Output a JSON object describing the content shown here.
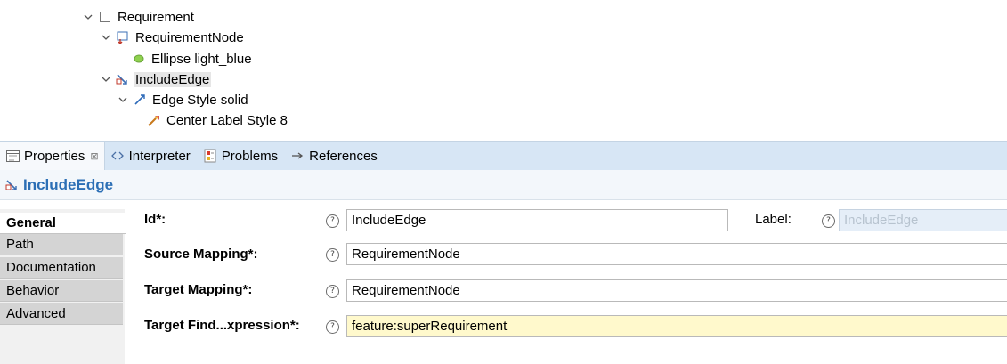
{
  "tree": {
    "items": [
      {
        "label": "Requirement",
        "icon": "document-icon",
        "expanded": true
      },
      {
        "label": "RequirementNode",
        "icon": "node-mapping-icon",
        "expanded": true
      },
      {
        "label": "Ellipse light_blue",
        "icon": "ellipse-icon"
      },
      {
        "label": "IncludeEdge",
        "icon": "edge-mapping-icon",
        "expanded": true,
        "selected": true
      },
      {
        "label": "Edge Style solid",
        "icon": "edge-style-icon",
        "expanded": true
      },
      {
        "label": "Center Label Style 8",
        "icon": "label-style-icon"
      }
    ]
  },
  "tabs": [
    {
      "label": "Properties",
      "icon": "properties-icon",
      "active": true,
      "close": "⊠"
    },
    {
      "label": "Interpreter",
      "icon": "interpreter-icon"
    },
    {
      "label": "Problems",
      "icon": "problems-icon"
    },
    {
      "label": "References",
      "icon": "references-icon"
    }
  ],
  "header": {
    "title": "IncludeEdge",
    "icon": "edge-mapping-icon"
  },
  "side_tabs": [
    "General",
    "Path",
    "Documentation",
    "Behavior",
    "Advanced"
  ],
  "active_side_tab": "General",
  "form": {
    "id_label": "Id*:",
    "id_value": "IncludeEdge",
    "label_label": "Label:",
    "label_value": "IncludeEdge",
    "source_label": "Source Mapping*:",
    "source_value": "RequirementNode",
    "target_label": "Target Mapping*:",
    "target_value": "RequirementNode",
    "find_label": "Target Find...xpression*:",
    "find_value": "feature:superRequirement",
    "help_glyph": "?"
  },
  "colors": {
    "tabbar_bg": "#d7e6f5",
    "header_title": "#2c6fb5",
    "expression_field_bg": "#fff9cc",
    "ellipse": "#8fd14f"
  }
}
